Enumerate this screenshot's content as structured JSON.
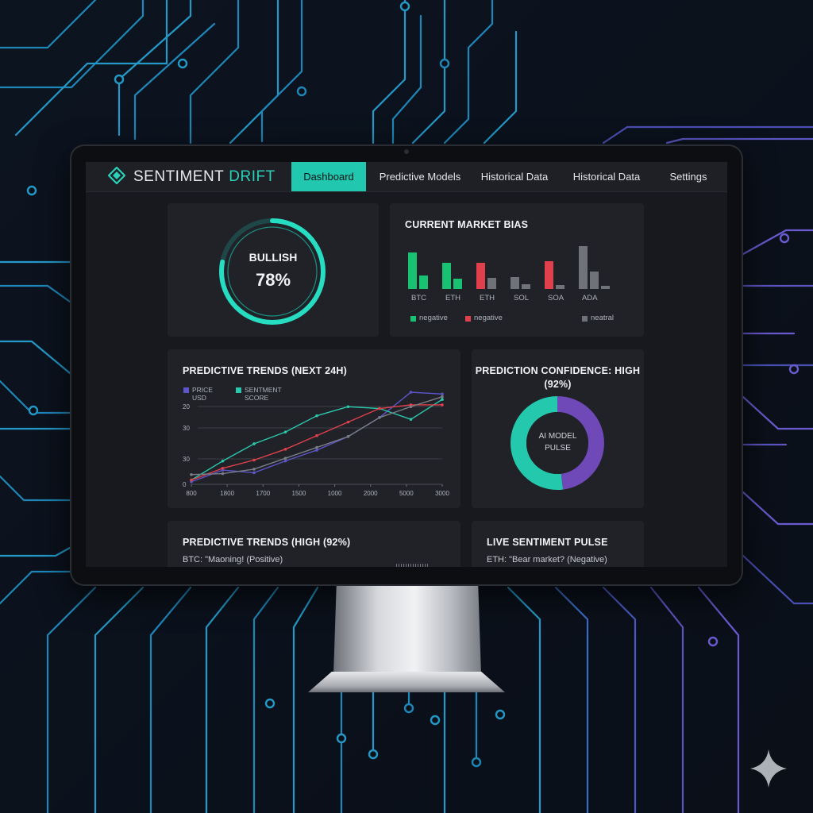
{
  "app": {
    "brand_part1": "SENTIMENT",
    "brand_part2": "DRIFT"
  },
  "nav": {
    "tabs": [
      {
        "label": "Dashboard",
        "active": true
      },
      {
        "label": "Predictive Models",
        "active": false
      },
      {
        "label": "Historical Data",
        "active": false
      },
      {
        "label": "Historical Data",
        "active": false
      },
      {
        "label": "Settings",
        "active": false
      }
    ]
  },
  "gauge": {
    "label": "BULLISH",
    "value_text": "78%",
    "value": 78
  },
  "market_bias": {
    "title": "CURRENT MARKET BIAS",
    "chart_data": {
      "type": "bar",
      "categories": [
        "BTC",
        "ETH",
        "ETH",
        "SOL",
        "SOA",
        "ADA"
      ],
      "series": [
        {
          "values": [
            67,
            48,
            48,
            22,
            52,
            80
          ]
        },
        {
          "values": [
            25,
            19,
            20,
            9,
            8,
            32
          ]
        },
        {
          "values": [
            0,
            0,
            0,
            0,
            0,
            6
          ]
        }
      ],
      "bar_colors": [
        [
          "#19c173",
          "#19c173"
        ],
        [
          "#19c173",
          "#19c173"
        ],
        [
          "#e0404c",
          "#6f7278"
        ],
        [
          "#6f7278",
          "#6f7278"
        ],
        [
          "#e0404c",
          "#6f7278"
        ],
        [
          "#6f7278",
          "#6f7278",
          "#6f7278"
        ]
      ],
      "legend": [
        {
          "label": "negative",
          "color": "#19c173"
        },
        {
          "label": "negative",
          "color": "#e0404c"
        },
        {
          "label": "neatral",
          "color": "#6f7278"
        }
      ]
    }
  },
  "trends": {
    "title": "PREDICTIVE TRENDS (NEXT 24H)",
    "chart_data": {
      "type": "line",
      "x_ticks": [
        "800",
        "1800",
        "1700",
        "1500",
        "1000",
        "2000",
        "5000",
        "3000"
      ],
      "y_ticks": [
        "0",
        "30",
        "30",
        "20"
      ],
      "legend": [
        {
          "label": "PRICE USD",
          "color": "#5d55c8"
        },
        {
          "label": "SENTMENT SCORE",
          "color": "#2bc7ac"
        }
      ],
      "series": [
        {
          "color": "#5d55c8",
          "values": [
            1,
            14,
            11,
            24,
            36,
            51,
            72,
            100,
            98
          ]
        },
        {
          "color": "#2bc7ac",
          "values": [
            3,
            24,
            43,
            56,
            74,
            84,
            82,
            70,
            92
          ]
        },
        {
          "color": "#e0404c",
          "values": [
            3,
            16,
            25,
            37,
            52,
            67,
            82,
            86,
            86
          ]
        },
        {
          "color": "#7a7d86",
          "values": [
            9,
            10,
            15,
            27,
            39,
            51,
            72,
            84,
            95
          ]
        }
      ]
    }
  },
  "confidence": {
    "title_line1": "PREDICTION CONFIDENCE: HIGH",
    "title_line2": "(92%)",
    "center_line1": "AI MODEL",
    "center_line2": "PULSE",
    "segments": [
      {
        "fraction": 0.48,
        "color": "#6f49b8"
      },
      {
        "fraction": 0.52,
        "color": "#24c9ad"
      }
    ]
  },
  "bottom_left": {
    "title": "PREDICTIVE TRENDS (HIGH (92%)",
    "text": "BTC: \"Maoning! (Positive)"
  },
  "bottom_right": {
    "title": "LIVE SENTIMENT PULSE",
    "text": "ETH: \"Bear market? (Negative)"
  }
}
